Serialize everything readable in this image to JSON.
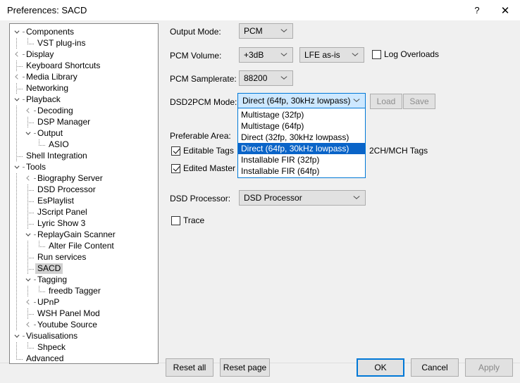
{
  "window": {
    "title": "Preferences: SACD",
    "help_icon": "question-mark-icon",
    "close_icon": "close-icon"
  },
  "sidebar": {
    "items": [
      {
        "label": "Components",
        "depth": 0,
        "expander": "down",
        "selected": false
      },
      {
        "label": "VST plug-ins",
        "depth": 1,
        "expander": "none",
        "selected": false
      },
      {
        "label": "Display",
        "depth": 0,
        "expander": "right",
        "selected": false
      },
      {
        "label": "Keyboard Shortcuts",
        "depth": 0,
        "expander": "none",
        "selected": false
      },
      {
        "label": "Media Library",
        "depth": 0,
        "expander": "right",
        "selected": false
      },
      {
        "label": "Networking",
        "depth": 0,
        "expander": "none",
        "selected": false
      },
      {
        "label": "Playback",
        "depth": 0,
        "expander": "down",
        "selected": false
      },
      {
        "label": "Decoding",
        "depth": 1,
        "expander": "right",
        "selected": false
      },
      {
        "label": "DSP Manager",
        "depth": 1,
        "expander": "none",
        "selected": false
      },
      {
        "label": "Output",
        "depth": 1,
        "expander": "down",
        "selected": false
      },
      {
        "label": "ASIO",
        "depth": 2,
        "expander": "none",
        "selected": false
      },
      {
        "label": "Shell Integration",
        "depth": 0,
        "expander": "none",
        "selected": false
      },
      {
        "label": "Tools",
        "depth": 0,
        "expander": "down",
        "selected": false
      },
      {
        "label": "Biography Server",
        "depth": 1,
        "expander": "right",
        "selected": false
      },
      {
        "label": "DSD Processor",
        "depth": 1,
        "expander": "none",
        "selected": false
      },
      {
        "label": "EsPlaylist",
        "depth": 1,
        "expander": "none",
        "selected": false
      },
      {
        "label": "JScript Panel",
        "depth": 1,
        "expander": "none",
        "selected": false
      },
      {
        "label": "Lyric Show 3",
        "depth": 1,
        "expander": "none",
        "selected": false
      },
      {
        "label": "ReplayGain Scanner",
        "depth": 1,
        "expander": "down",
        "selected": false
      },
      {
        "label": "Alter File Content",
        "depth": 2,
        "expander": "none",
        "selected": false
      },
      {
        "label": "Run services",
        "depth": 1,
        "expander": "none",
        "selected": false
      },
      {
        "label": "SACD",
        "depth": 1,
        "expander": "none",
        "selected": true
      },
      {
        "label": "Tagging",
        "depth": 1,
        "expander": "down",
        "selected": false
      },
      {
        "label": "freedb Tagger",
        "depth": 2,
        "expander": "none",
        "selected": false
      },
      {
        "label": "UPnP",
        "depth": 1,
        "expander": "right",
        "selected": false
      },
      {
        "label": "WSH Panel Mod",
        "depth": 1,
        "expander": "none",
        "selected": false
      },
      {
        "label": "Youtube Source",
        "depth": 1,
        "expander": "right",
        "selected": false
      },
      {
        "label": "Visualisations",
        "depth": 0,
        "expander": "down",
        "selected": false
      },
      {
        "label": "Shpeck",
        "depth": 1,
        "expander": "none",
        "selected": false
      },
      {
        "label": "Advanced",
        "depth": 0,
        "expander": "none",
        "selected": false
      }
    ]
  },
  "form": {
    "output_mode": {
      "label": "Output Mode:",
      "value": "PCM"
    },
    "pcm_volume": {
      "label": "PCM Volume:",
      "value": "+3dB",
      "lfe_value": "LFE as-is",
      "log_overloads_label": "Log Overloads",
      "log_overloads_checked": false
    },
    "pcm_samplerate": {
      "label": "PCM Samplerate:",
      "value": "88200"
    },
    "dsd2pcm_mode": {
      "label": "DSD2PCM Mode:",
      "value": "Direct (64fp, 30kHz lowpass)",
      "expanded": true,
      "options": [
        "Multistage (32fp)",
        "Multistage (64fp)",
        "Direct (32fp, 30kHz lowpass)",
        "Direct (64fp, 30kHz lowpass)",
        "Installable FIR (32fp)",
        "Installable FIR (64fp)"
      ],
      "selected_index": 3,
      "load_label": "Load",
      "save_label": "Save"
    },
    "preferable_area": {
      "label": "Preferable Area:"
    },
    "editable_tags": {
      "label": "Editable Tags",
      "checked": true
    },
    "tags_2ch_mch": {
      "label": "2CH/MCH Tags"
    },
    "edited_master_playback": {
      "label": "Edited Master Playback",
      "checked": true
    },
    "dsd_processor": {
      "label": "DSD Processor:",
      "value": "DSD Processor"
    },
    "trace": {
      "label": "Trace",
      "checked": false
    }
  },
  "footer": {
    "reset_all": "Reset all",
    "reset_page": "Reset page",
    "ok": "OK",
    "cancel": "Cancel",
    "apply": "Apply"
  },
  "colors": {
    "accent": "#0078d7",
    "selection": "#0a64c8",
    "dialog_bg": "#f0f0f0",
    "control_bg": "#e1e1e1",
    "control_border": "#adadad",
    "combo_open_bg": "#cde8ff",
    "tree_selection": "#d0d0d0"
  }
}
